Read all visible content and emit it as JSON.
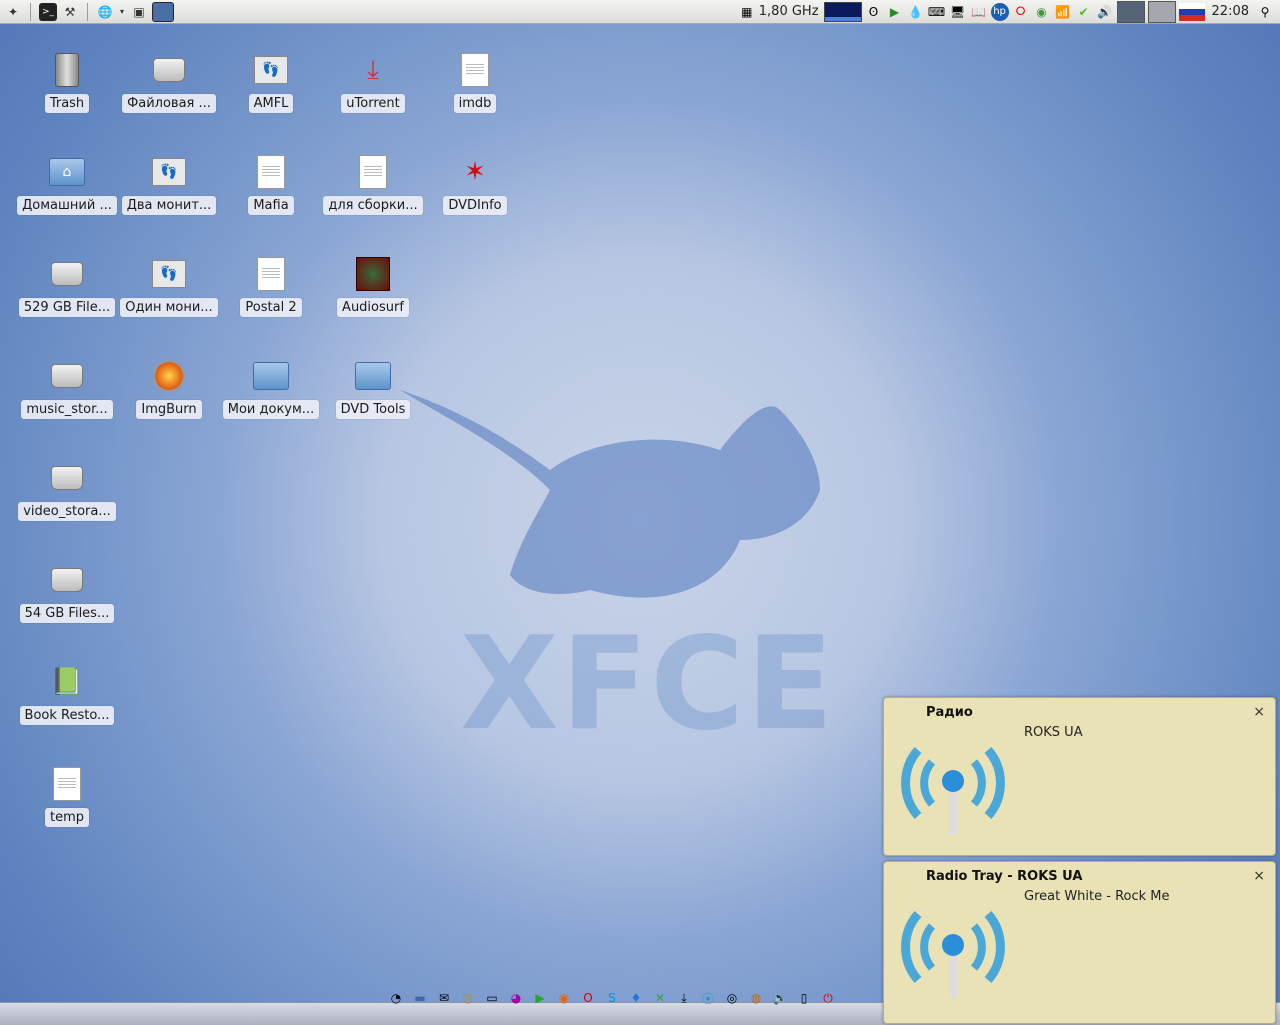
{
  "top_panel": {
    "cpu_freq": "1,80 GHz",
    "clock": "22:08",
    "left_icons": [
      "xfce-menu-icon",
      "terminal-icon",
      "settings-icon",
      "browser-icon",
      "screenshot-icon",
      "desktop-icon"
    ],
    "tray_icons": [
      "network-icon",
      "play-icon",
      "drop-icon",
      "keyboard-icon",
      "display-icon",
      "book-icon",
      "hp-icon",
      "opera-icon",
      "update-icon",
      "wifi-icon",
      "check-icon",
      "volume-icon"
    ]
  },
  "desktop_icons": [
    {
      "label": "Trash",
      "type": "trash"
    },
    {
      "label": "Файловая ...",
      "type": "drive"
    },
    {
      "label": "AMFL",
      "type": "app"
    },
    {
      "label": "uTorrent",
      "type": "app"
    },
    {
      "label": "imdb",
      "type": "doc"
    },
    {
      "label": "Домашний ...",
      "type": "folder"
    },
    {
      "label": "Два монит...",
      "type": "app"
    },
    {
      "label": "Mafia",
      "type": "doc"
    },
    {
      "label": "для сборки...",
      "type": "doc"
    },
    {
      "label": "DVDInfo",
      "type": "app"
    },
    {
      "label": "529 GB File...",
      "type": "drive"
    },
    {
      "label": "Один мони...",
      "type": "app"
    },
    {
      "label": "Postal 2",
      "type": "doc"
    },
    {
      "label": "Audiosurf",
      "type": "app"
    },
    {
      "label": "music_stor...",
      "type": "drive"
    },
    {
      "label": "ImgBurn",
      "type": "app"
    },
    {
      "label": "Мои докум...",
      "type": "folder"
    },
    {
      "label": "DVD Tools",
      "type": "folder"
    },
    {
      "label": "video_stora...",
      "type": "drive"
    },
    {
      "label": "54 GB Files...",
      "type": "drive"
    },
    {
      "label": "Book Resto...",
      "type": "app"
    },
    {
      "label": "temp",
      "type": "doc"
    }
  ],
  "wallpaper": {
    "logo_text": "XFCE"
  },
  "notifications": [
    {
      "title": "Радио",
      "body": "ROKS UA",
      "close": "×"
    },
    {
      "title": "Radio Tray - ROKS UA",
      "body": "Great White - Rock Me",
      "close": "×"
    }
  ],
  "dock": {
    "items": [
      "clock-icon",
      "folder-icon",
      "mail-icon",
      "timer-icon",
      "screen-icon",
      "pidgin-icon",
      "media-icon",
      "firefox-icon",
      "opera-icon",
      "skype-icon",
      "drop-icon",
      "tools-icon",
      "torrent-icon",
      "radio-icon",
      "disk-icon",
      "chrome-icon",
      "volume-icon",
      "trash-icon",
      "power-icon"
    ]
  },
  "colors": {
    "notif_bg": "#e9e2b6",
    "panel_bg": "#e8e8e4",
    "accent": "#3f67ad"
  }
}
